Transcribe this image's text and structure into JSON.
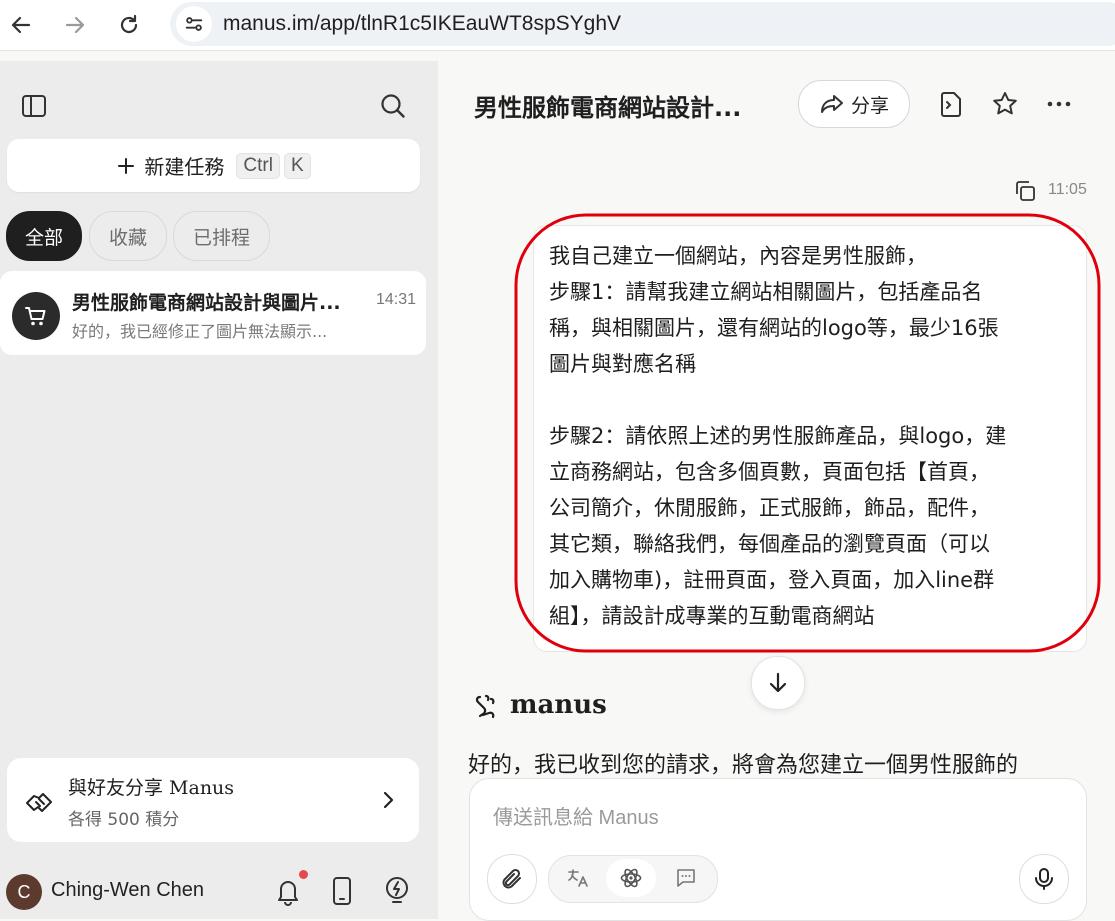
{
  "browser": {
    "url": "manus.im/app/tlnR1c5IKEauWT8spSYghV",
    "icons": {
      "back": "arrow-left-icon",
      "forward": "arrow-right-icon",
      "reload": "reload-icon",
      "site_info": "tune-icon"
    }
  },
  "sidebar": {
    "new_task": {
      "label": "新建任務",
      "shortcut_ctrl": "Ctrl",
      "shortcut_key": "K"
    },
    "filters": [
      {
        "label": "全部",
        "active": true
      },
      {
        "label": "收藏",
        "active": false
      },
      {
        "label": "已排程",
        "active": false
      }
    ],
    "tasks": [
      {
        "title": "男性服飾電商網站設計與圖片...",
        "time": "14:31",
        "snippet": "好的，我已經修正了圖片無法顯示..."
      }
    ],
    "share_card": {
      "title": "與好友分享 Manus",
      "subtitle": "各得 500 積分"
    },
    "user": {
      "initial": "C",
      "name": "Ching-Wen Chen",
      "notification_dot_color": "#e5484d"
    }
  },
  "main": {
    "title": "男性服飾電商網站設計...",
    "share_label": "分享",
    "message_time": "11:05",
    "user_message": "我自己建立一個網站，內容是男性服飾，\n步驟1：請幫我建立網站相關圖片，包括產品名\n稱，與相關圖片，還有網站的logo等，最少16張\n圖片與對應名稱\n\n步驟2：請依照上述的男性服飾產品，與logo，建\n立商務網站，包含多個頁數，頁面包括【首頁，\n公司簡介，休閒服飾，正式服飾，飾品，配件，\n其它類，聯絡我們，每個產品的瀏覽頁面（可以\n加入購物車)，註冊頁面，登入頁面，加入line群\n組】，請設計成專業的互動電商網站",
    "assistant_name": "manus",
    "assistant_reply": "好的，我已收到您的請求，將會為您建立一個男性服飾的",
    "composer_placeholder": "傳送訊息給 Manus",
    "highlight_color": "#e0000b"
  }
}
